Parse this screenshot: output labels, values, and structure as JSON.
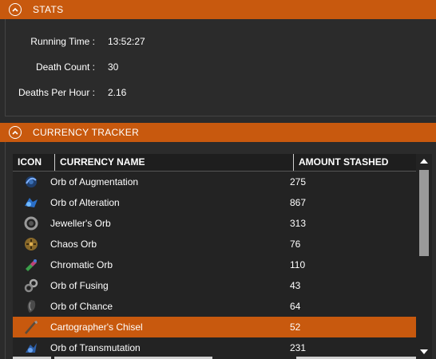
{
  "stats": {
    "header": "STATS",
    "rows": [
      {
        "label": "Running Time :",
        "value": "13:52:27"
      },
      {
        "label": "Death Count :",
        "value": "30"
      },
      {
        "label": "Deaths Per Hour :",
        "value": "2.16"
      }
    ]
  },
  "tracker": {
    "header": "CURRENCY TRACKER",
    "columns": {
      "icon": "ICON",
      "name": "CURRENCY NAME",
      "amount": "AMOUNT STASHED"
    },
    "rows": [
      {
        "icon": "orb-of-augmentation-icon",
        "name": "Orb of Augmentation",
        "amount": "275"
      },
      {
        "icon": "orb-of-alteration-icon",
        "name": "Orb of Alteration",
        "amount": "867"
      },
      {
        "icon": "jewellers-orb-icon",
        "name": "Jeweller's Orb",
        "amount": "313"
      },
      {
        "icon": "chaos-orb-icon",
        "name": "Chaos Orb",
        "amount": "76"
      },
      {
        "icon": "chromatic-orb-icon",
        "name": "Chromatic Orb",
        "amount": "110"
      },
      {
        "icon": "orb-of-fusing-icon",
        "name": "Orb of Fusing",
        "amount": "43"
      },
      {
        "icon": "orb-of-chance-icon",
        "name": "Orb of Chance",
        "amount": "64"
      },
      {
        "icon": "cartographers-chisel-icon",
        "name": "Cartographer's Chisel",
        "amount": "52",
        "selected": true
      },
      {
        "icon": "orb-of-transmutation-icon",
        "name": "Orb of Transmutation",
        "amount": "231"
      }
    ]
  },
  "colors": {
    "accent": "#c8590e",
    "background": "#2b2b2b",
    "table": "#232323"
  }
}
